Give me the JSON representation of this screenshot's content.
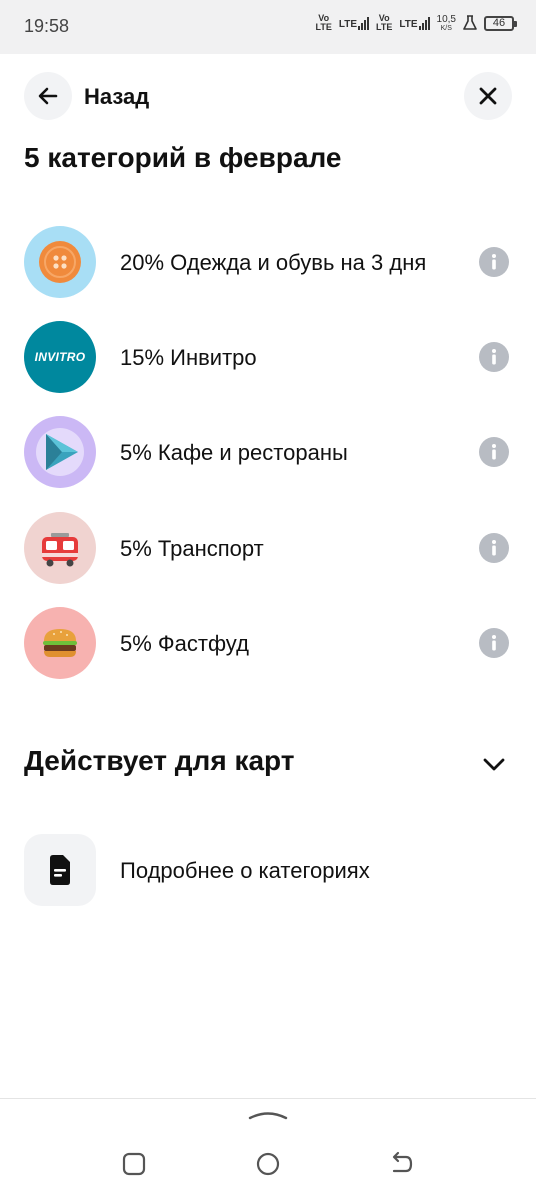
{
  "status_bar": {
    "time": "19:58",
    "volte1_top": "Vo",
    "volte1_bottom": "LTE",
    "lte1": "LTE",
    "volte2_top": "Vo",
    "volte2_bottom": "LTE",
    "lte2": "LTE",
    "speed_value": "10,5",
    "speed_unit": "K/S",
    "battery": "46"
  },
  "header": {
    "back_label": "Назад"
  },
  "title": "5 категорий в феврале",
  "categories": [
    {
      "label": "20% Одежда и обувь на 3 дня",
      "icon": "button-icon",
      "bg": "#a8def5"
    },
    {
      "label": "15% Инвитро",
      "icon": "invitro-logo",
      "logo_text": "INVITRO",
      "bg": "#00889e"
    },
    {
      "label": "5% Кафе и рестораны",
      "icon": "play-icon",
      "bg": "#cbb8f5"
    },
    {
      "label": "5% Транспорт",
      "icon": "tram-icon",
      "bg": "#f0d3d0"
    },
    {
      "label": "5% Фастфуд",
      "icon": "burger-icon",
      "bg": "#f7b2b0"
    }
  ],
  "section": {
    "title": "Действует для карт"
  },
  "more_link": {
    "label": "Подробнее о категориях"
  },
  "colors": {
    "text": "#111111",
    "info_icon": "#b8bcc3",
    "button_bg": "#f2f3f5"
  }
}
